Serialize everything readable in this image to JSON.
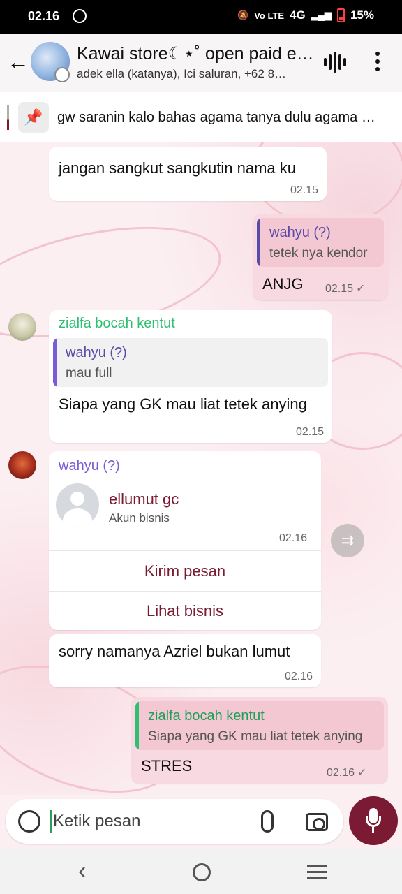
{
  "status_bar": {
    "time": "02.16",
    "battery": "15%",
    "network": "4G",
    "volte": "Vo LTE",
    "icons": [
      "whatsapp-icon",
      "mute-icon",
      "signal-icon",
      "battery-icon"
    ]
  },
  "header": {
    "title": "Kawai store☾⋆˚ open paid e…",
    "subtitle": "adek ella (katanya), Ici saluran, +62 8…",
    "icons": [
      "back-arrow-icon",
      "group-avatar",
      "voice-chat-icon",
      "more-vert-icon"
    ]
  },
  "pinned": {
    "text": "gw saranin kalo bahas agama tanya dulu agama …",
    "icon": "pin-icon"
  },
  "messages": [
    {
      "type": "in",
      "text": "jangan sangkut sangkutin nama ku",
      "time": "02.15"
    },
    {
      "type": "out",
      "quote_name": "wahyu (?)",
      "quote_text": "tetek nya kendor",
      "text": "ANJG",
      "time": "02.15"
    },
    {
      "type": "in",
      "sender": "zialfa bocah kentut",
      "quote_name": "wahyu (?)",
      "quote_text": "mau full",
      "text": "Siapa yang GK mau liat tetek anying",
      "time": "02.15"
    },
    {
      "type": "in",
      "sender": "wahyu (?)",
      "contact_name": "ellumut gc",
      "contact_sub": "Akun bisnis",
      "time": "02.16",
      "action1": "Kirim pesan",
      "action2": "Lihat bisnis"
    },
    {
      "type": "in",
      "text": "sorry namanya Azriel bukan lumut",
      "time": "02.16"
    },
    {
      "type": "out",
      "quote_name": "zialfa bocah kentut",
      "quote_text": "Siapa yang GK mau liat tetek anying",
      "text": "STRES",
      "time": "02.16"
    }
  ],
  "input": {
    "placeholder": "Ketik pesan"
  },
  "colors": {
    "accent": "#7a1a33",
    "outgoing_bubble": "#f9d9e1",
    "quote_purple": "#5a4ba8",
    "sender_green": "#2fbf71",
    "sender_purple": "#7a5cd6",
    "action_text": "#7a1a33"
  }
}
